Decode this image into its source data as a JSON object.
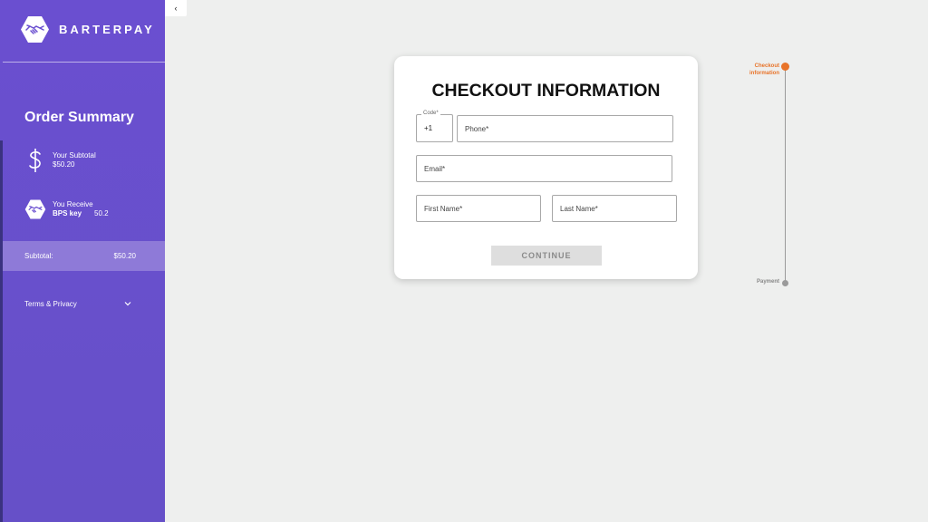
{
  "brand": {
    "name": "BARTERPAY",
    "logo_icon": "handshake-hexagon-icon"
  },
  "sidebar": {
    "title": "Order Summary",
    "subtotal_row": {
      "icon": "dollar-icon",
      "label": "Your Subtotal",
      "value": "$50.20"
    },
    "receive_row": {
      "icon": "handshake-hexagon-icon",
      "label": "You Receive",
      "item": "BPS key",
      "amount": "50.2"
    },
    "subtotal_bar": {
      "label": "Subtotal:",
      "value": "$50.20"
    },
    "terms": {
      "label": "Terms & Privacy",
      "icon": "chevron-down-icon"
    },
    "collapse_button": {
      "icon": "chevron-left-icon",
      "glyph": "‹"
    }
  },
  "form": {
    "title": "CHECKOUT INFORMATION",
    "code_label": "Code*",
    "code_value": "+1",
    "phone_placeholder": "Phone*",
    "email_placeholder": "Email*",
    "first_name_placeholder": "First Name*",
    "last_name_placeholder": "Last Name*",
    "continue_label": "CONTINUE"
  },
  "stepper": {
    "steps": [
      {
        "label_line1": "Checkout",
        "label_line2": "information",
        "state": "active"
      },
      {
        "label_line1": "Payment",
        "label_line2": "",
        "state": "inactive"
      }
    ]
  },
  "colors": {
    "sidebar": "#6a4fd0",
    "subtotal_bar": "#8e7ad8",
    "active_step": "#e8742a",
    "inactive_step": "#9a9a9a",
    "page_bg": "#eeefee"
  }
}
